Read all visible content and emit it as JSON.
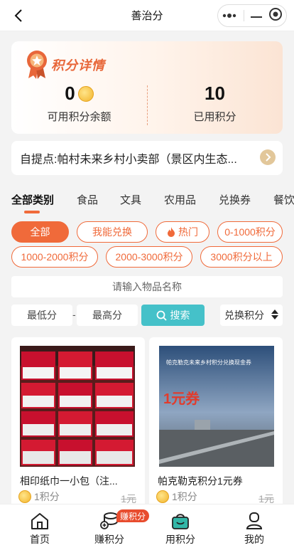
{
  "titlebar": {
    "title": "善治分"
  },
  "points": {
    "card_title": "积分详情",
    "available_value": "0",
    "available_label": "可用积分余额",
    "used_value": "10",
    "used_label": "已用积分"
  },
  "pickup": {
    "text": "自提点:帕村未来乡村小卖部（景区内生态..."
  },
  "tabs": [
    "全部类别",
    "食品",
    "文具",
    "农用品",
    "兑换券",
    "餐饮"
  ],
  "chips": [
    "全部",
    "我能兑换",
    "热门",
    "0-1000积分",
    "1000-2000积分",
    "2000-3000积分",
    "3000积分以上"
  ],
  "search": {
    "placeholder": "请输入物品名称",
    "min_placeholder": "最低分",
    "dash": "-",
    "max_placeholder": "最高分",
    "button_label": "搜索",
    "sort_label": "兑换积分"
  },
  "products": [
    {
      "name": "相印纸巾一小包（注...",
      "points": "1积分",
      "original": "1元",
      "image_text": ""
    },
    {
      "name": "帕克勒克积分1元券",
      "points": "1积分",
      "original": "1元",
      "image_text": "帕克勒克未来乡村积分兑换现金券",
      "image_big": "1元券"
    }
  ],
  "nav": [
    {
      "label": "首页",
      "icon": "home-icon"
    },
    {
      "label": "赚积分",
      "icon": "earn-coins-icon"
    },
    {
      "label": "用积分",
      "icon": "shopping-basket-icon"
    },
    {
      "label": "我的",
      "icon": "user-icon"
    }
  ],
  "nav_badge": "赚积分",
  "colors": {
    "accent": "#f06a3a",
    "search_button": "#45c1c9",
    "badge": "#e84c2e"
  }
}
